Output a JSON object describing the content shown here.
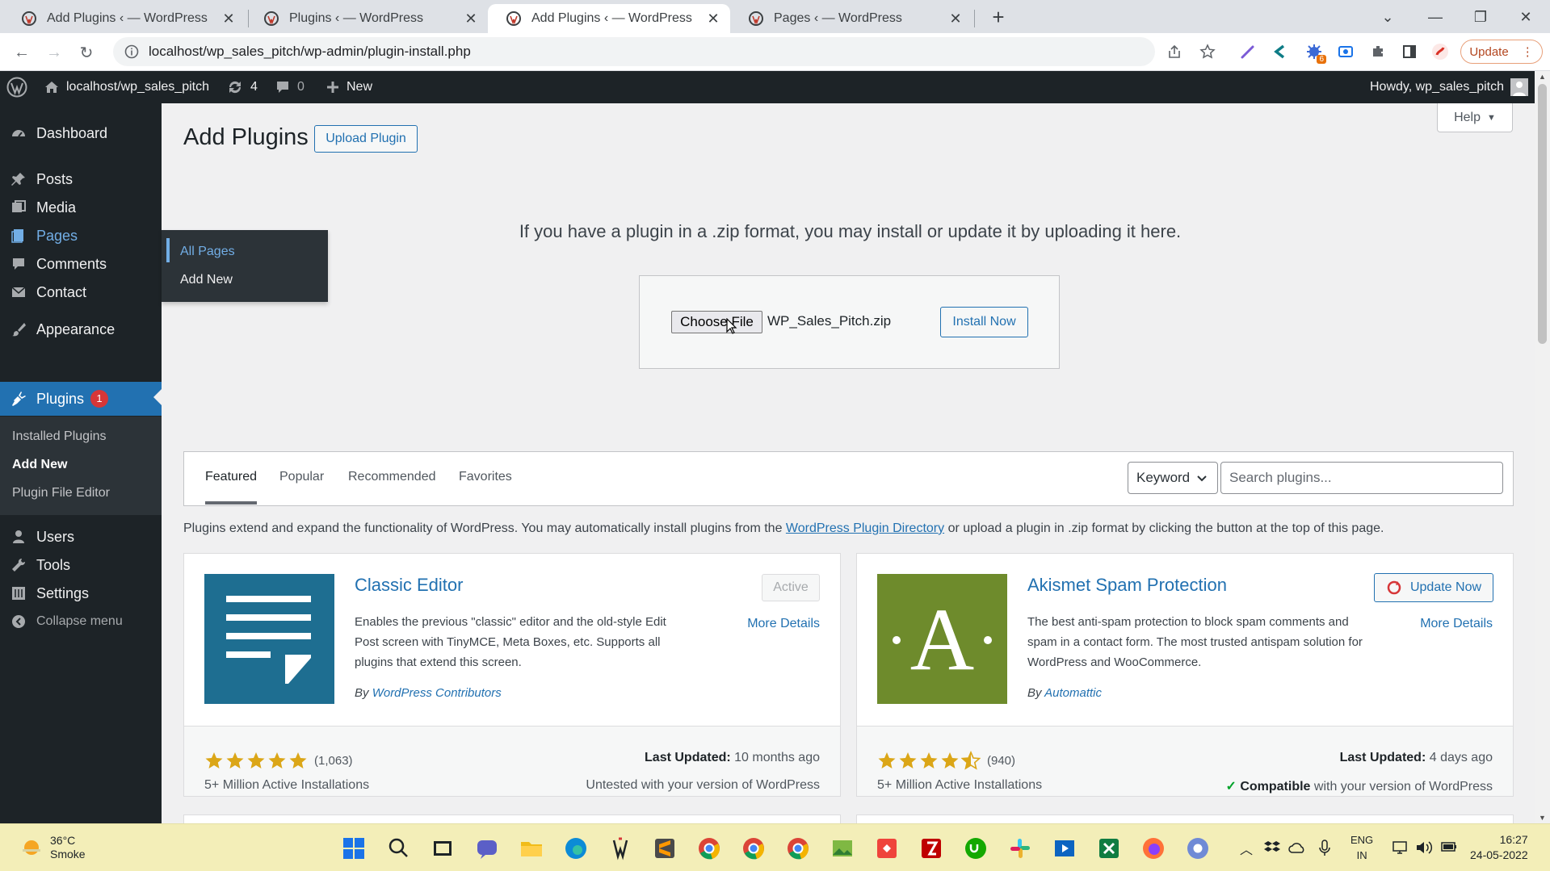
{
  "browser": {
    "tabs": [
      {
        "title": "Add Plugins ‹ — WordPress",
        "active": false
      },
      {
        "title": "Plugins ‹ — WordPress",
        "active": false
      },
      {
        "title": "Add Plugins ‹ — WordPress",
        "active": true
      },
      {
        "title": "Pages ‹ — WordPress",
        "active": false
      }
    ],
    "url": "localhost/wp_sales_pitch/wp-admin/plugin-install.php",
    "update_label": "Update",
    "extension_badge": "6"
  },
  "adminbar": {
    "site_name": "localhost/wp_sales_pitch",
    "updates_count": "4",
    "comments_count": "0",
    "new_label": "New",
    "howdy": "Howdy, wp_sales_pitch"
  },
  "sidebar": {
    "dashboard": "Dashboard",
    "posts": "Posts",
    "media": "Media",
    "pages": "Pages",
    "comments": "Comments",
    "contact": "Contact",
    "appearance": "Appearance",
    "plugins": "Plugins",
    "plugins_badge": "1",
    "plugins_submenu": [
      "Installed Plugins",
      "Add New",
      "Plugin File Editor"
    ],
    "users": "Users",
    "tools": "Tools",
    "settings": "Settings",
    "collapse": "Collapse menu",
    "pages_flyout": [
      "All Pages",
      "Add New"
    ]
  },
  "page": {
    "title": "Add Plugins",
    "upload_button": "Upload Plugin",
    "help_label": "Help",
    "upload_help": "If you have a plugin in a .zip format, you may install or update it by uploading it here.",
    "choose_file": "Choose File",
    "file_name": "WP_Sales_Pitch.zip",
    "install_now": "Install Now"
  },
  "filter": {
    "tabs": [
      "Featured",
      "Popular",
      "Recommended",
      "Favorites"
    ],
    "active_tab": "Featured",
    "search_type": "Keyword",
    "search_placeholder": "Search plugins..."
  },
  "intro": {
    "before": "Plugins extend and expand the functionality of WordPress. You may automatically install plugins from the ",
    "link": "WordPress Plugin Directory",
    "after": " or upload a plugin in .zip format by clicking the button at the top of this page."
  },
  "plugins": [
    {
      "name": "Classic Editor",
      "description": "Enables the previous \"classic\" editor and the old-style Edit Post screen with TinyMCE, Meta Boxes, etc. Supports all plugins that extend this screen.",
      "by": "By",
      "author": "WordPress Contributors",
      "action": "Active",
      "more": "More Details",
      "rating": 5,
      "ratings_count": "(1,063)",
      "installs": "5+ Million Active Installations",
      "last_updated_label": "Last Updated:",
      "last_updated": "10 months ago",
      "compat_text": "Untested with your version of WordPress",
      "icon_color": "#1e6e91"
    },
    {
      "name": "Akismet Spam Protection",
      "description": "The best anti-spam protection to block spam comments and spam in a contact form. The most trusted antispam solution for WordPress and WooCommerce.",
      "by": "By",
      "author": "Automattic",
      "action": "Update Now",
      "more": "More Details",
      "rating": 4.5,
      "ratings_count": "(940)",
      "installs": "5+ Million Active Installations",
      "last_updated_label": "Last Updated:",
      "last_updated": "4 days ago",
      "compat_strong": "Compatible",
      "compat_rest": " with your version of WordPress",
      "icon_letter": "·A·",
      "icon_color": "#6e8b2c"
    }
  ],
  "taskbar": {
    "temperature": "36°C",
    "condition": "Smoke",
    "lang_line1": "ENG",
    "lang_line2": "IN",
    "time": "16:27",
    "date": "24-05-2022"
  }
}
